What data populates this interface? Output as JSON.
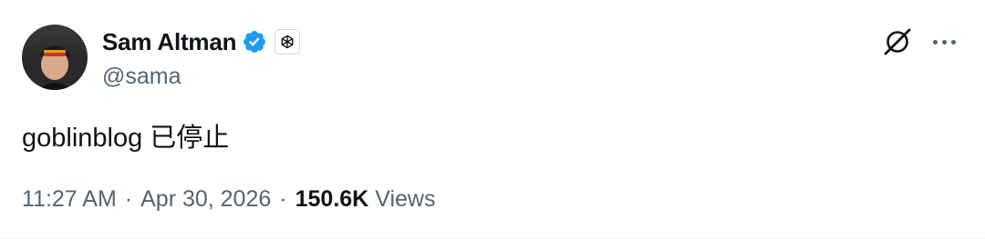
{
  "author": {
    "display_name": "Sam Altman",
    "handle": "@sama",
    "verified": true,
    "verified_color": "#1d9bf0",
    "affiliation_icon": "openai-logo-icon"
  },
  "header_actions": {
    "grok_icon": "grok-icon",
    "more_icon": "more-icon"
  },
  "tweet": {
    "text": "goblinblog 已停止"
  },
  "meta": {
    "time": "11:27 AM",
    "separator": "·",
    "date": "Apr 30, 2026",
    "views_count": "150.6K",
    "views_label": "Views"
  },
  "colors": {
    "text_primary": "#0f1419",
    "text_secondary": "#536471",
    "accent": "#1d9bf0"
  }
}
